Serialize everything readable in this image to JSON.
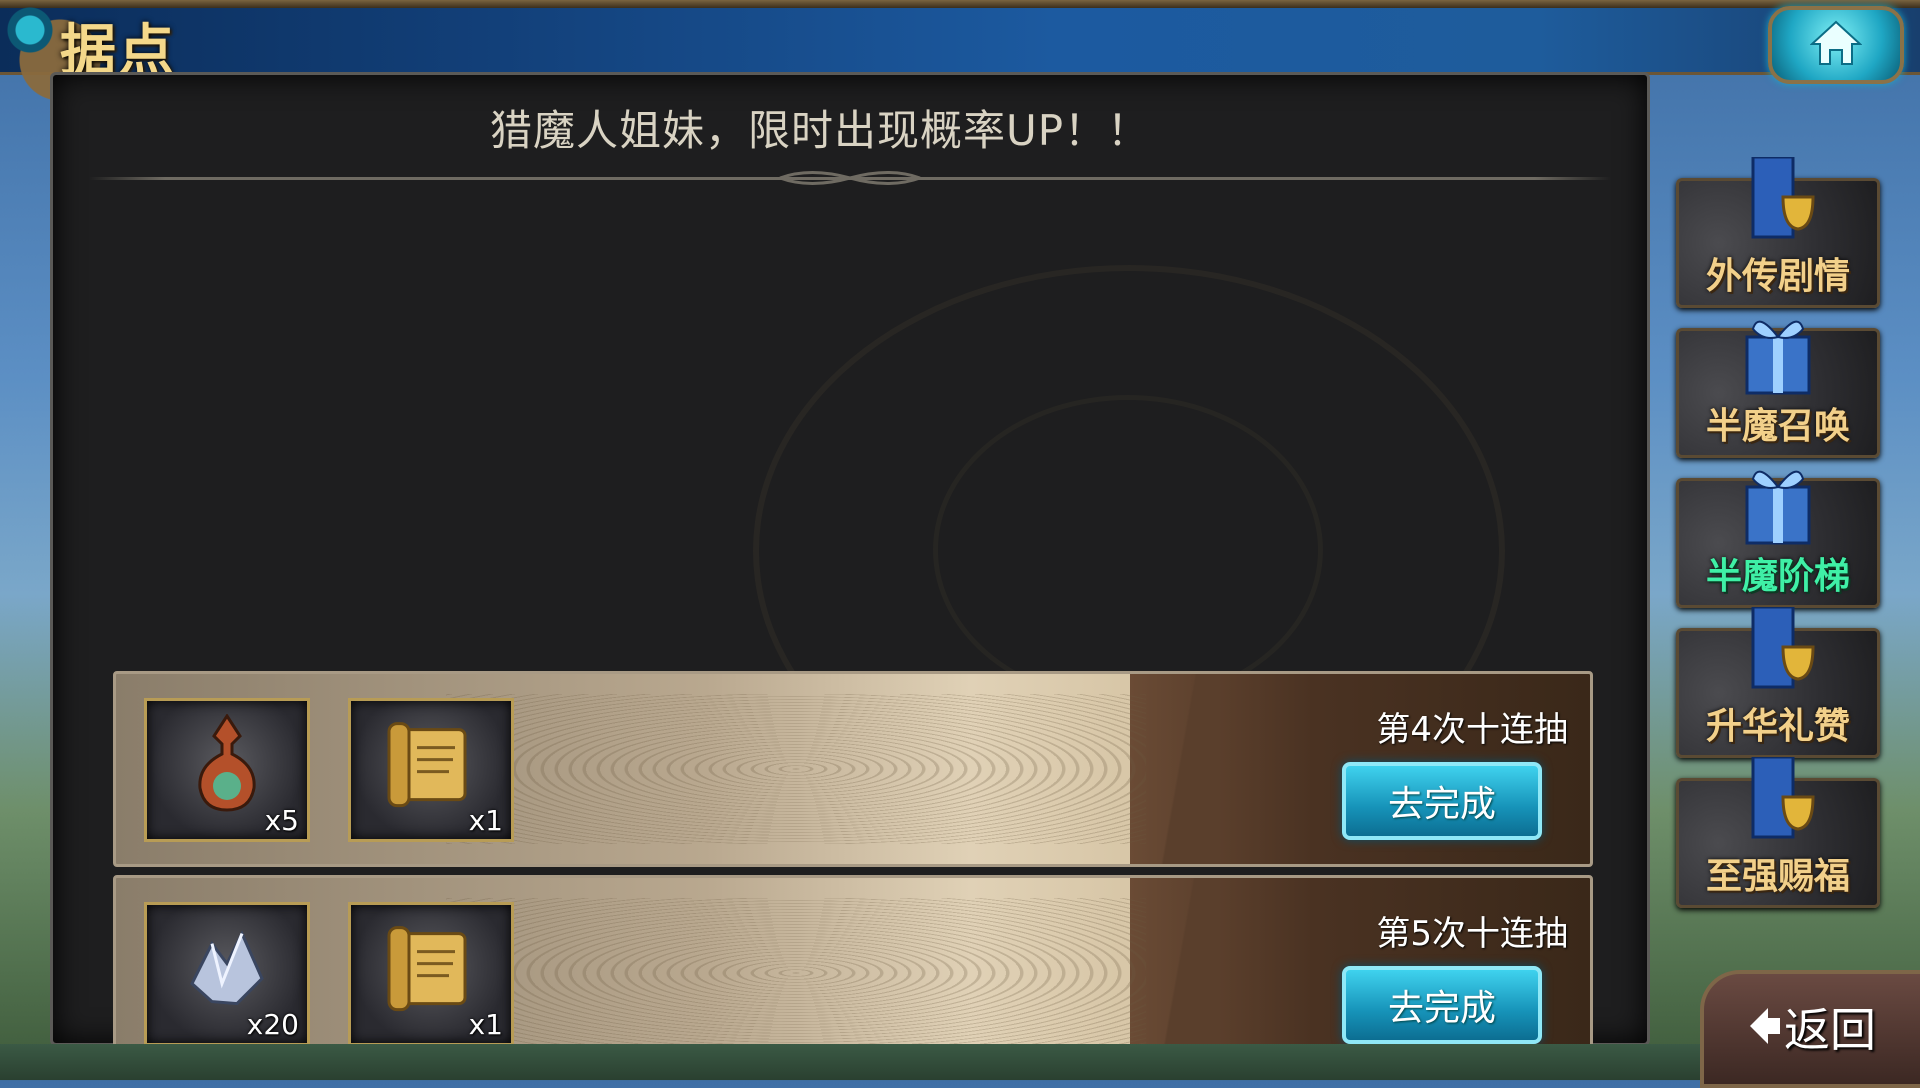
{
  "header": {
    "title": "据点"
  },
  "panel": {
    "banner": "猎魔人姐妹，限时出现概率UP！！"
  },
  "tasks": [
    {
      "label": "第4次十连抽",
      "button": "去完成",
      "rewards": [
        {
          "icon": "potion-icon",
          "count": "x5"
        },
        {
          "icon": "scroll-icon",
          "count": "x1"
        }
      ]
    },
    {
      "label": "第5次十连抽",
      "button": "去完成",
      "rewards": [
        {
          "icon": "crystal-icon",
          "count": "x20"
        },
        {
          "icon": "scroll-icon",
          "count": "x1"
        }
      ]
    }
  ],
  "sidebar": {
    "items": [
      {
        "label": "外传剧情",
        "icon": "trophy-banner-icon"
      },
      {
        "label": "半魔召唤",
        "icon": "gift-box-icon"
      },
      {
        "label": "半魔阶梯",
        "icon": "gift-box-icon",
        "active": true
      },
      {
        "label": "升华礼赞",
        "icon": "trophy-banner-icon"
      },
      {
        "label": "至强赐福",
        "icon": "trophy-banner-icon"
      }
    ]
  },
  "back": {
    "label": "返回"
  },
  "colors": {
    "active_tab_text": "#3ff0a6",
    "tab_text": "#f2d08a",
    "go_button": "#1692b8"
  }
}
